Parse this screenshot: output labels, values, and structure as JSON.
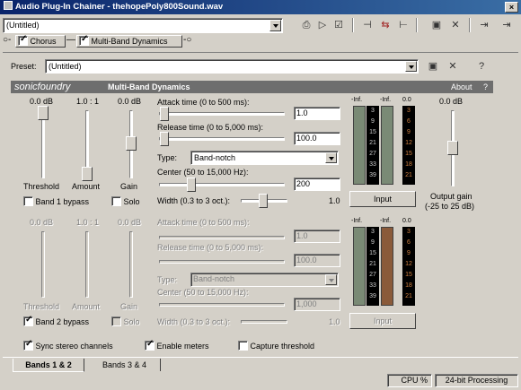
{
  "window": {
    "title": "Audio Plug-In Chainer - thehopePoly800Sound.wav",
    "close": "×"
  },
  "preset_top": {
    "value": "(Untitled)"
  },
  "chain": {
    "chorus": "Chorus",
    "multiband": "Multi-Band Dynamics"
  },
  "preset": {
    "label": "Preset:",
    "value": "(Untitled)"
  },
  "plugin_header": {
    "brand": "sonicfoundry",
    "name": "Multi-Band Dynamics",
    "about": "About",
    "help": "?"
  },
  "band1": {
    "threshold_val": "0.0 dB",
    "amount_val": "1.0 : 1",
    "gain_val": "0.0 dB",
    "threshold_label": "Threshold",
    "amount_label": "Amount",
    "gain_label": "Gain",
    "bypass_label": "Band 1 bypass",
    "solo_label": "Solo",
    "attack_label": "Attack time (0 to 500 ms):",
    "attack_val": "1.0",
    "release_label": "Release time (0 to 5,000 ms):",
    "release_val": "100.0",
    "type_label": "Type:",
    "type_val": "Band-notch",
    "center_label": "Center (50 to 15,000 Hz):",
    "center_val": "200",
    "width_label": "Width (0.3 to 3 oct.):",
    "width_val": "1.0",
    "input_btn": "Input"
  },
  "band2": {
    "threshold_val": "0.0 dB",
    "amount_val": "1.0 : 1",
    "gain_val": "0.0 dB",
    "threshold_label": "Threshold",
    "amount_label": "Amount",
    "gain_label": "Gain",
    "bypass_label": "Band 2 bypass",
    "solo_label": "Solo",
    "attack_label": "Attack time (0 to 500 ms):",
    "attack_val": "1.0",
    "release_label": "Release time (0 to 5,000 ms):",
    "release_val": "100.0",
    "type_label": "Type:",
    "type_val": "Band-notch",
    "center_label": "Center (50 to 15,000 Hz):",
    "center_val": "1,000",
    "width_label": "Width (0.3 to 3 oct.):",
    "width_val": "1.0",
    "input_btn": "Input"
  },
  "meter_labels": {
    "inf1": "-Inf.",
    "inf2": "-Inf.",
    "zero": "0.0"
  },
  "meter_scale_left": [
    "3",
    "9",
    "15",
    "21",
    "27",
    "33",
    "39"
  ],
  "meter_scale_right": [
    "3",
    "6",
    "9",
    "12",
    "15",
    "18",
    "21"
  ],
  "output": {
    "value": "0.0 dB",
    "label": "Output gain",
    "range": "(-25 to 25 dB)"
  },
  "options": {
    "sync": "Sync stereo channels",
    "meters": "Enable meters",
    "capture": "Capture threshold"
  },
  "tabs": {
    "tab1": "Bands 1 & 2",
    "tab2": "Bands 3 & 4"
  },
  "status": {
    "cpu": "CPU %",
    "bits": "24-bit Processing"
  }
}
